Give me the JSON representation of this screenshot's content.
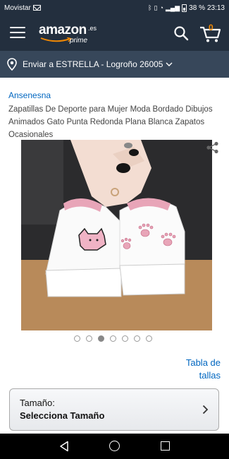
{
  "status_bar": {
    "carrier": "Movistar",
    "battery_percent": "38 %",
    "time": "23:13"
  },
  "header": {
    "logo_text": "amazon",
    "logo_tld": ".es",
    "logo_sub": "prime",
    "cart_count": "0",
    "accent_color": "#f08804"
  },
  "delivery": {
    "text": "Enviar a ESTRELLA - Logroño 26005"
  },
  "product": {
    "brand": "Ansenesna",
    "title": "Zapatillas De Deporte para Mujer Moda Bordado Dibujos Animados Gato Punta Redonda Plana Blanca Zapatos Ocasionales",
    "image_count": 7,
    "active_image_index": 2
  },
  "size_chart": {
    "line1": "Tabla de",
    "line2": "tallas"
  },
  "size_selector": {
    "label": "Tamaño:",
    "value": "Selecciona Tamaño"
  },
  "colors": {
    "header_bg": "#232f3e",
    "delivery_bg": "#37475a",
    "link": "#0066c0"
  }
}
